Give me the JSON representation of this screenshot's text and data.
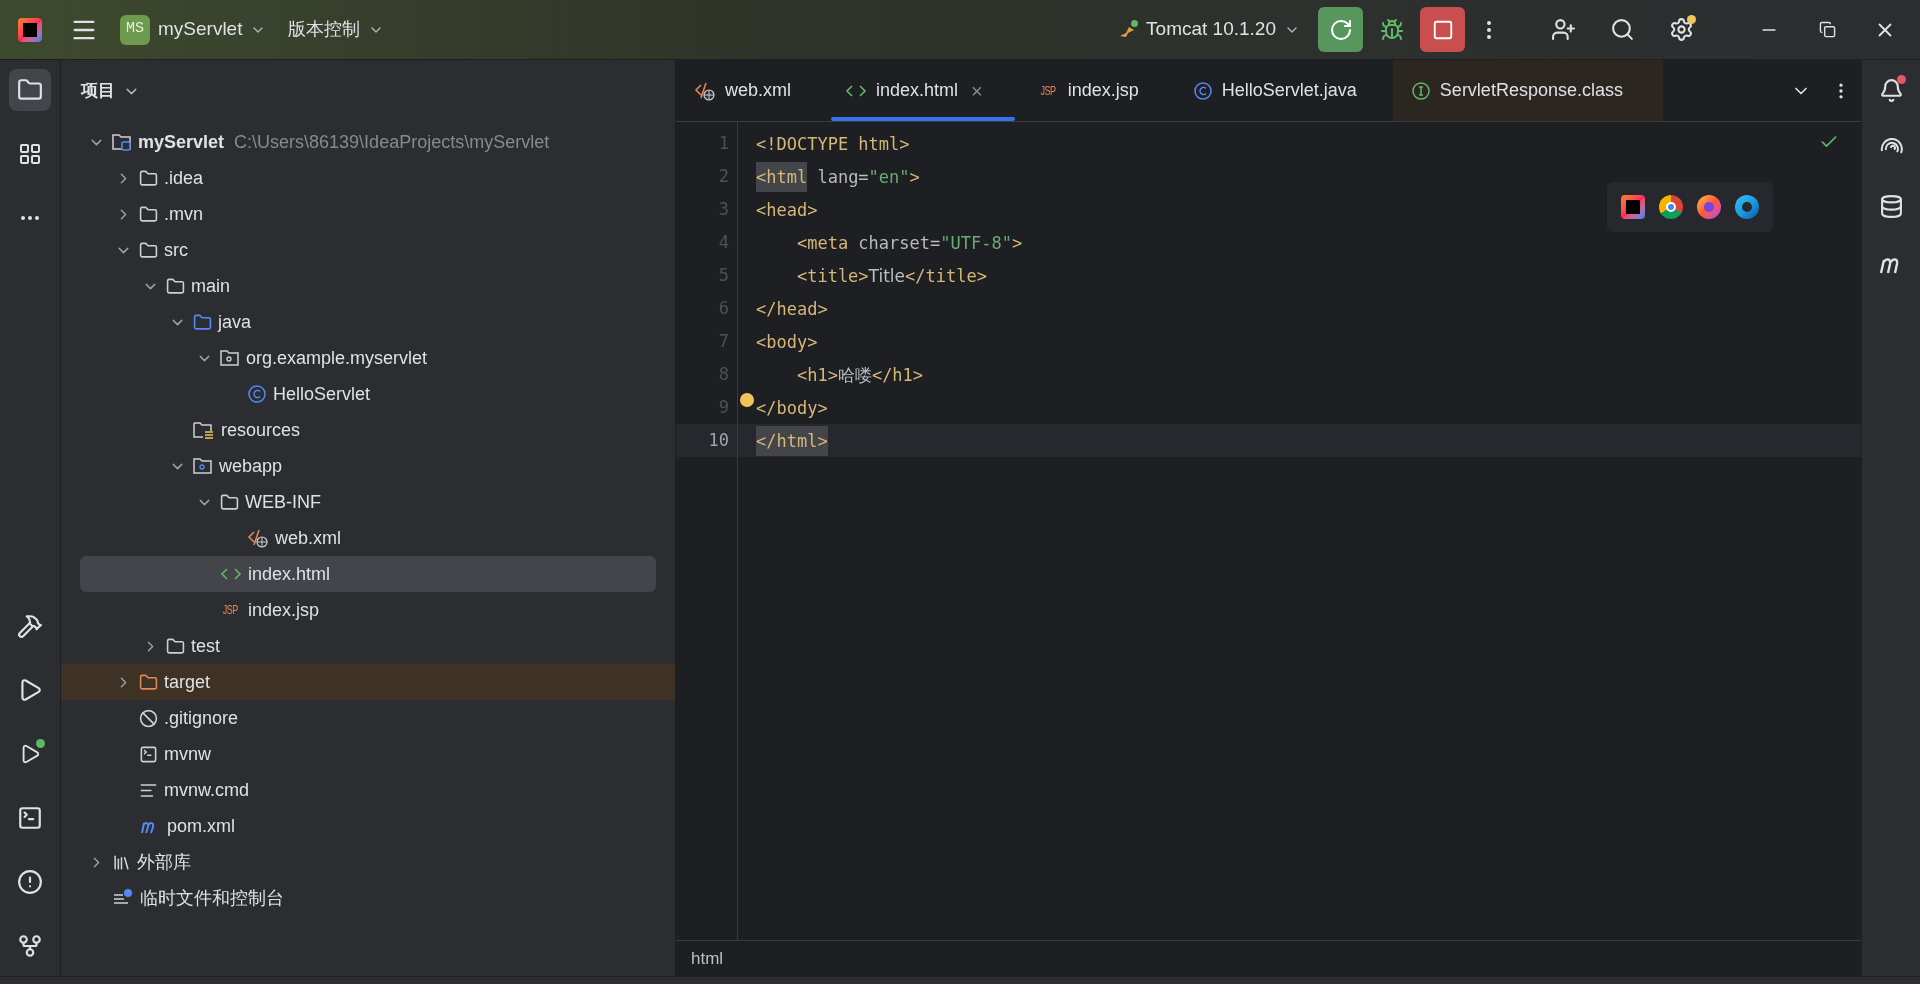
{
  "title_bar": {
    "project": {
      "badge": "MS",
      "name": "myServlet"
    },
    "vcs": "版本控制",
    "run_config": "Tomcat 10.1.20"
  },
  "project_panel": {
    "title": "项目",
    "tree": [
      {
        "kind": "project",
        "label": "myServlet",
        "hint": "C:\\Users\\86139\\IdeaProjects\\myServlet",
        "expanded": true,
        "selected": false,
        "children": [
          {
            "kind": "folder",
            "label": ".idea",
            "expanded": false,
            "selected": false
          },
          {
            "kind": "folder",
            "label": ".mvn",
            "expanded": false,
            "selected": false
          },
          {
            "kind": "folder",
            "label": "src",
            "expanded": true,
            "selected": false,
            "children": [
              {
                "kind": "folder",
                "label": "main",
                "expanded": true,
                "selected": false,
                "children": [
                  {
                    "kind": "source-folder",
                    "label": "java",
                    "expanded": true,
                    "selected": false,
                    "children": [
                      {
                        "kind": "package",
                        "label": "org.example.myservlet",
                        "expanded": true,
                        "selected": false,
                        "children": [
                          {
                            "kind": "class",
                            "label": "HelloServlet",
                            "selected": false
                          }
                        ]
                      }
                    ]
                  },
                  {
                    "kind": "resources-folder",
                    "label": "resources",
                    "selected": false
                  },
                  {
                    "kind": "web-folder",
                    "label": "webapp",
                    "expanded": true,
                    "selected": false,
                    "children": [
                      {
                        "kind": "folder",
                        "label": "WEB-INF",
                        "expanded": true,
                        "selected": false,
                        "children": [
                          {
                            "kind": "xml",
                            "label": "web.xml",
                            "selected": false
                          }
                        ]
                      },
                      {
                        "kind": "html",
                        "label": "index.html",
                        "selected": true
                      },
                      {
                        "kind": "jsp",
                        "icon_text": "JSP",
                        "label": "index.jsp",
                        "selected": false
                      }
                    ]
                  }
                ]
              },
              {
                "kind": "folder",
                "label": "test",
                "expanded": false,
                "selected": false
              }
            ]
          },
          {
            "kind": "excluded-folder",
            "label": "target",
            "expanded": false,
            "selected": false
          },
          {
            "kind": "gitignore",
            "label": ".gitignore",
            "selected": false
          },
          {
            "kind": "script",
            "label": "mvnw",
            "selected": false
          },
          {
            "kind": "text",
            "label": "mvnw.cmd",
            "selected": false
          },
          {
            "kind": "maven",
            "label": "pom.xml",
            "selected": false
          }
        ]
      },
      {
        "kind": "library",
        "label": "外部库",
        "expanded": false,
        "selected": false
      },
      {
        "kind": "scratch",
        "label": "临时文件和控制台",
        "selected": false
      }
    ]
  },
  "editor_tabs": [
    {
      "kind": "xml",
      "label": "web.xml",
      "selected": false,
      "closable": false,
      "tinted": false
    },
    {
      "kind": "html",
      "label": "index.html",
      "selected": true,
      "closable": true,
      "tinted": false
    },
    {
      "kind": "jsp",
      "icon_text": "JSP",
      "label": "index.jsp",
      "selected": false,
      "closable": false,
      "tinted": false
    },
    {
      "kind": "class",
      "label": "HelloServlet.java",
      "selected": false,
      "closable": false,
      "tinted": false
    },
    {
      "kind": "interface",
      "label": "ServletResponse.class",
      "selected": false,
      "closable": false,
      "tinted": true
    }
  ],
  "close_glyph": "×",
  "code_lines": [
    {
      "number": "1",
      "current": false,
      "segments": [
        {
          "kind": "tag",
          "text": "<!DOCTYPE html>",
          "matched": false
        }
      ]
    },
    {
      "number": "2",
      "current": false,
      "segments": [
        {
          "kind": "tag",
          "text": "<html",
          "matched": true
        },
        {
          "kind": "attr",
          "text": " lang=",
          "matched": false
        },
        {
          "kind": "string",
          "text": "\"en\"",
          "matched": false
        },
        {
          "kind": "tag",
          "text": ">",
          "matched": false
        }
      ]
    },
    {
      "number": "3",
      "current": false,
      "segments": [
        {
          "kind": "tag",
          "text": "<head>",
          "matched": false
        }
      ]
    },
    {
      "number": "4",
      "current": false,
      "segments": [
        {
          "kind": "tag",
          "text": "    <meta",
          "matched": false
        },
        {
          "kind": "attr",
          "text": " charset=",
          "matched": false
        },
        {
          "kind": "string",
          "text": "\"UTF-8\"",
          "matched": false
        },
        {
          "kind": "tag",
          "text": ">",
          "matched": false
        }
      ]
    },
    {
      "number": "5",
      "current": false,
      "segments": [
        {
          "kind": "tag",
          "text": "    <title>",
          "matched": false
        },
        {
          "kind": "text",
          "text": "Title",
          "matched": false
        },
        {
          "kind": "tag",
          "text": "</title>",
          "matched": false
        }
      ]
    },
    {
      "number": "6",
      "current": false,
      "segments": [
        {
          "kind": "tag",
          "text": "</head>",
          "matched": false
        }
      ]
    },
    {
      "number": "7",
      "current": false,
      "segments": [
        {
          "kind": "tag",
          "text": "<body>",
          "matched": false
        }
      ]
    },
    {
      "number": "8",
      "current": false,
      "segments": [
        {
          "kind": "tag",
          "text": "    <h1>",
          "matched": false
        },
        {
          "kind": "text",
          "text": "哈喽",
          "matched": false
        },
        {
          "kind": "tag",
          "text": "</h1>",
          "matched": false
        }
      ]
    },
    {
      "number": "9",
      "current": false,
      "bulb": true,
      "segments": [
        {
          "kind": "tag",
          "text": "</body>",
          "matched": false
        }
      ]
    },
    {
      "number": "10",
      "current": true,
      "segments": [
        {
          "kind": "tag",
          "text": "</html>",
          "matched": true
        }
      ]
    }
  ],
  "breadcrumb": "html"
}
